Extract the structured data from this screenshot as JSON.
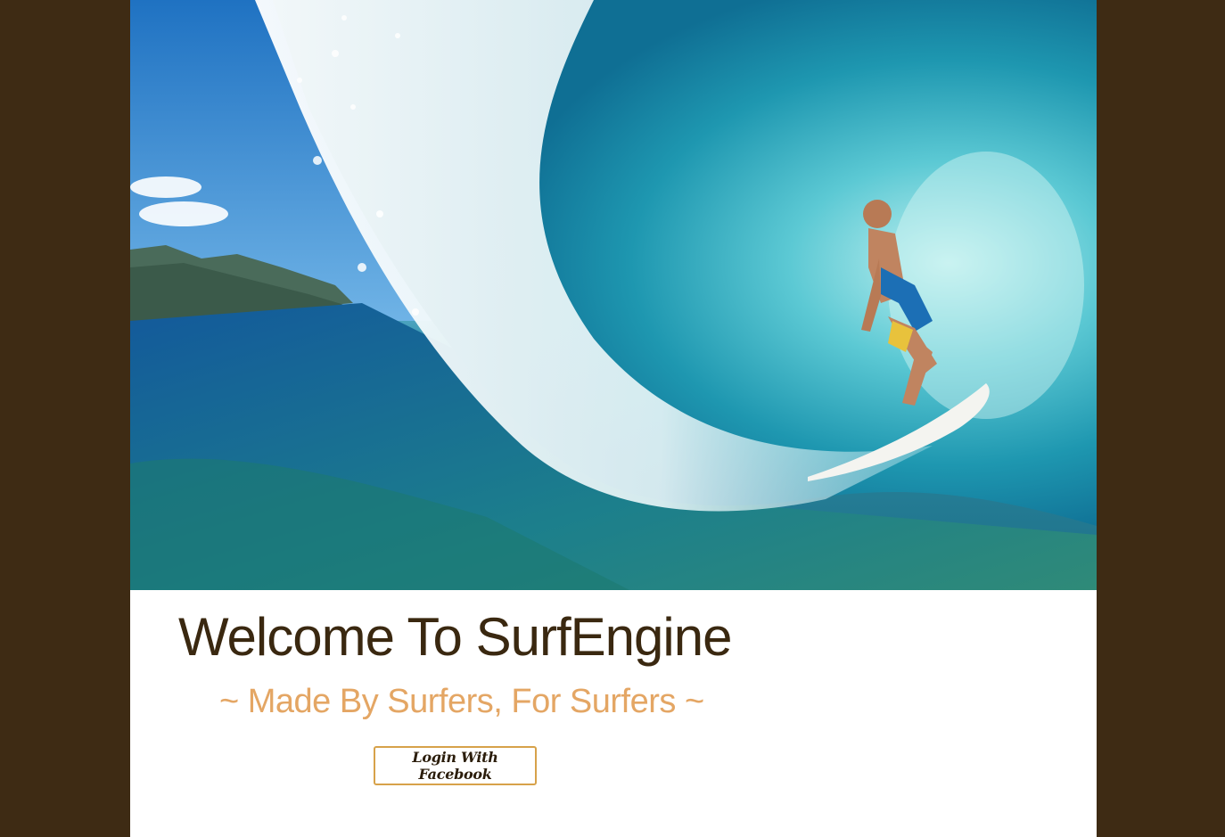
{
  "hero": {
    "image_name": "surfer-barrel-wave-photo"
  },
  "welcome": {
    "title": "Welcome To SurfEngine",
    "tagline": "~ Made By Surfers, For Surfers ~"
  },
  "actions": {
    "login_label": "Login With Facebook"
  },
  "colors": {
    "background": "#3e2b14",
    "content": "#ffffff",
    "title": "#3a2810",
    "tagline": "#e4a664",
    "button_border": "#d7a24a"
  }
}
